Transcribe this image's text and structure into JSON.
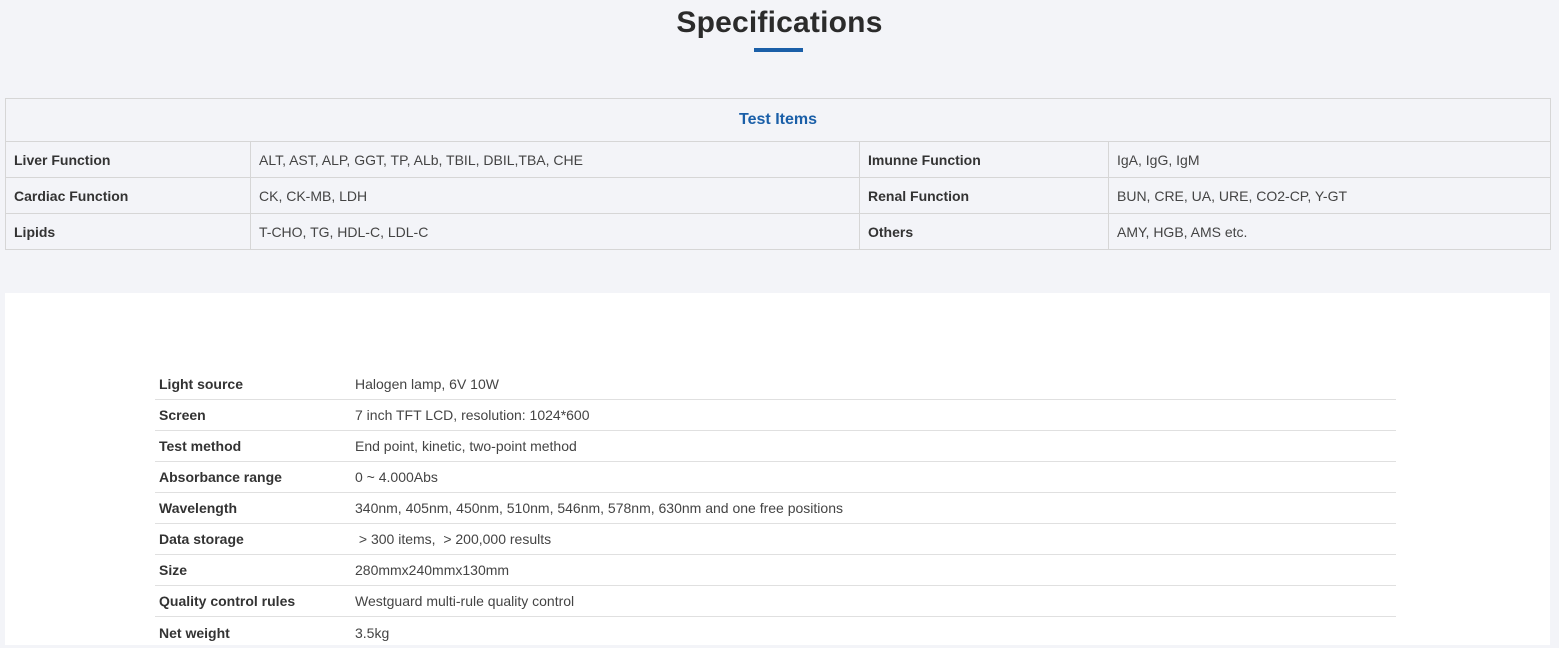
{
  "header": {
    "title": "Specifications"
  },
  "test_items": {
    "heading": "Test Items",
    "rows": [
      {
        "left_label": "Liver Function",
        "left_value": "ALT, AST, ALP, GGT, TP, ALb, TBIL, DBIL,TBA, CHE",
        "right_label": "Imunne Function",
        "right_value": "IgA, IgG, IgM"
      },
      {
        "left_label": "Cardiac Function",
        "left_value": "CK, CK-MB, LDH",
        "right_label": "Renal Function",
        "right_value": "BUN, CRE, UA, URE, CO2-CP, Y-GT"
      },
      {
        "left_label": "Lipids",
        "left_value": "T-CHO, TG, HDL-C, LDL-C",
        "right_label": "Others",
        "right_value": "AMY, HGB, AMS etc."
      }
    ]
  },
  "specs": [
    {
      "label": "Light source",
      "value": "Halogen lamp, 6V 10W"
    },
    {
      "label": "Screen",
      "value": "7 inch TFT LCD, resolution: 1024*600"
    },
    {
      "label": "Test method",
      "value": "End point, kinetic, two-point method"
    },
    {
      "label": "Absorbance range",
      "value": "0 ~ 4.000Abs"
    },
    {
      "label": "Wavelength",
      "value": "340nm, 405nm, 450nm, 510nm, 546nm, 578nm, 630nm and one free positions"
    },
    {
      "label": "Data storage",
      "value": " > 300 items,  > 200,000 results"
    },
    {
      "label": "Size",
      "value": "280mmx240mmx130mm"
    },
    {
      "label": "Quality control rules",
      "value": "Westguard multi-rule quality control"
    },
    {
      "label": "Net weight",
      "value": "3.5kg"
    }
  ],
  "colors": {
    "accent": "#1a5fa8",
    "background": "#f3f4f8",
    "panel": "#ffffff"
  }
}
